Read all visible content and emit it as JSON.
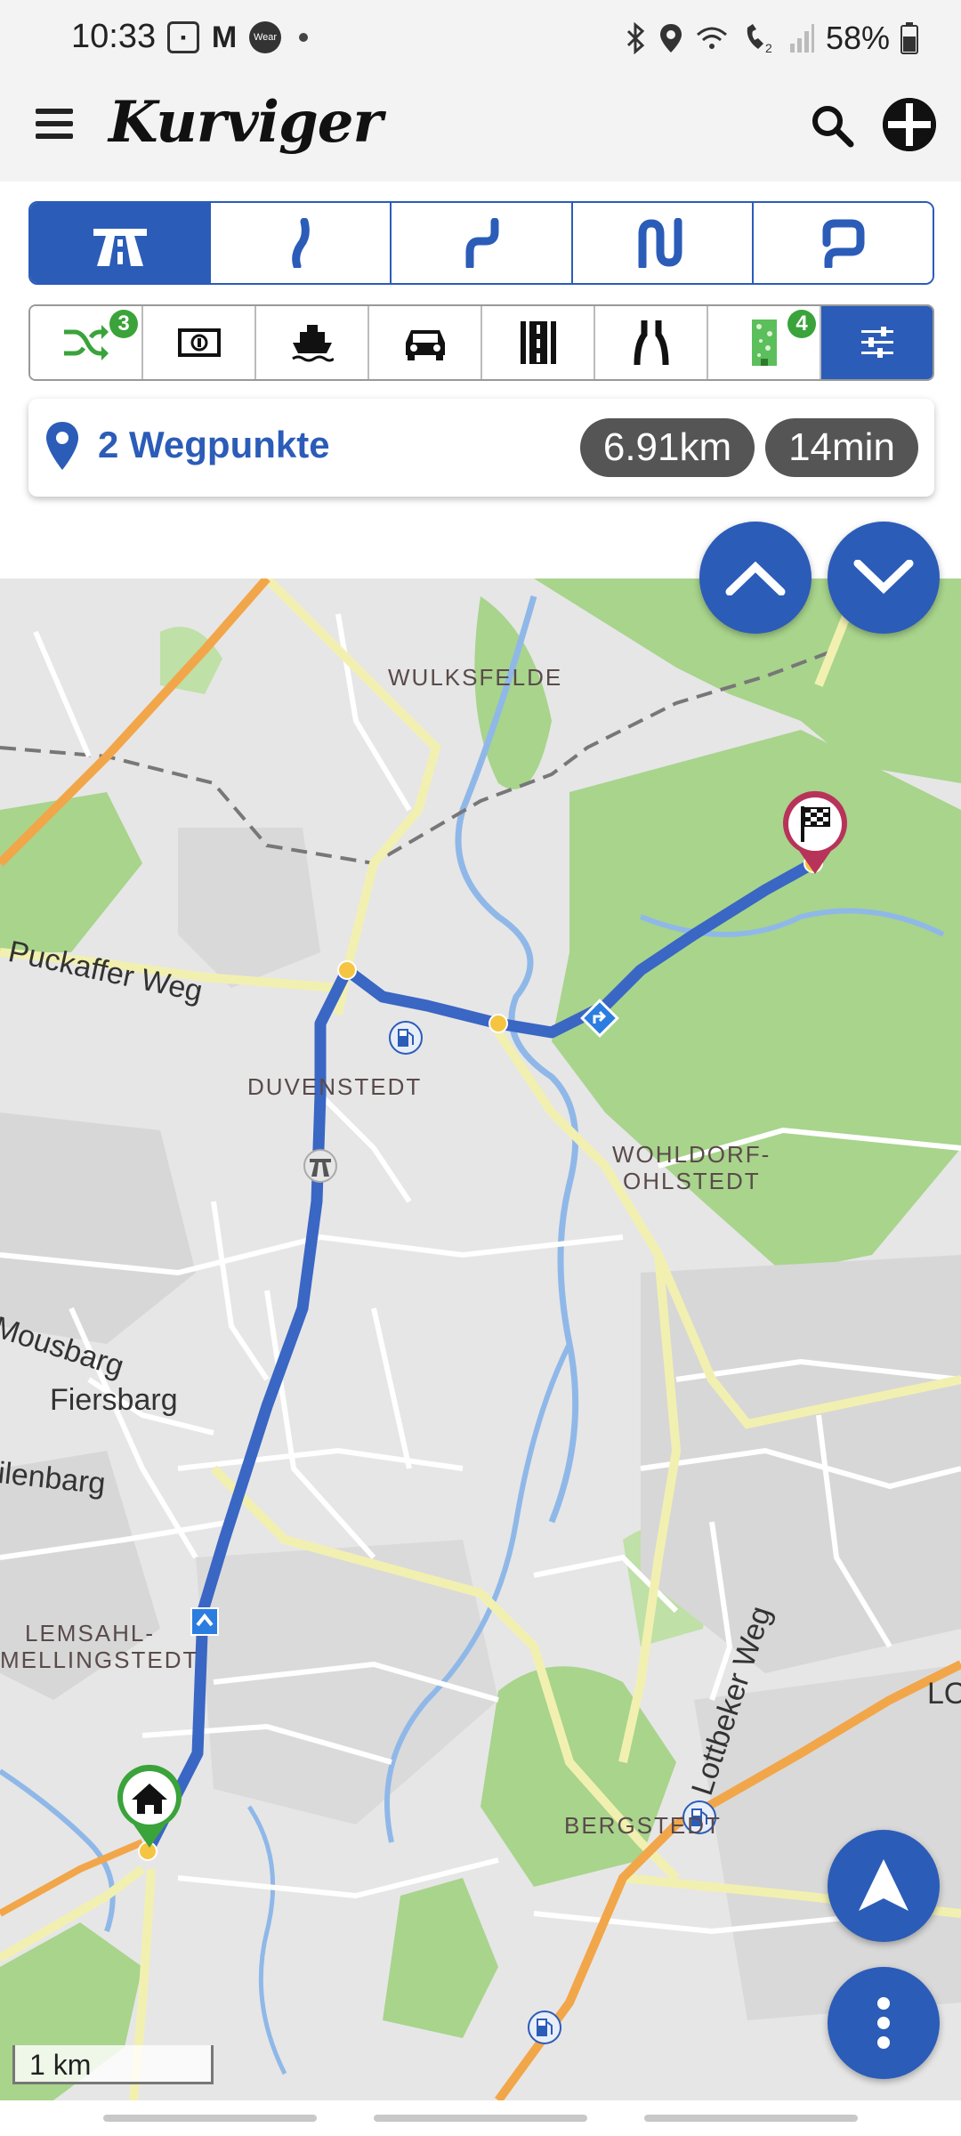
{
  "status_bar": {
    "time": "10:33",
    "battery": "58%",
    "wear_label": "Wear",
    "icons": [
      "folder-icon",
      "gmail-icon",
      "wear-icon",
      "dot-icon",
      "bluetooth-icon",
      "location-icon",
      "wifi-call-icon",
      "vowifi-icon",
      "signal-icon",
      "battery-icon"
    ]
  },
  "app_bar": {
    "logo": "Kurviger",
    "icons": [
      "menu-icon",
      "search-icon",
      "profile-icon"
    ]
  },
  "curviness": {
    "options": [
      {
        "name": "motorway",
        "icon": "motorway-icon",
        "active": true
      },
      {
        "name": "slightly-curvy",
        "icon": "curve-slight-icon",
        "active": false
      },
      {
        "name": "curvy",
        "icon": "curve-medium-icon",
        "active": false
      },
      {
        "name": "very-curvy",
        "icon": "curve-strong-icon",
        "active": false
      },
      {
        "name": "extreme-curvy",
        "icon": "curve-extreme-icon",
        "active": false
      }
    ]
  },
  "route_options": {
    "items": [
      {
        "icon": "shuffle-icon",
        "badge": "3",
        "active": false
      },
      {
        "icon": "toll-money-icon",
        "badge": "",
        "active": false
      },
      {
        "icon": "ferry-icon",
        "badge": "",
        "active": false
      },
      {
        "icon": "car-icon",
        "badge": "",
        "active": false
      },
      {
        "icon": "road-icon",
        "badge": "",
        "active": false
      },
      {
        "icon": "narrow-road-icon",
        "badge": "",
        "active": false
      },
      {
        "icon": "unpaved-road-icon",
        "badge": "4",
        "active": false
      },
      {
        "icon": "settings-sliders-icon",
        "badge": "",
        "active": true
      }
    ]
  },
  "route_summary": {
    "waypoints_label": "2 Wegpunkte",
    "distance": "6.91km",
    "duration": "14min"
  },
  "map": {
    "place_labels": [
      "WULKSFELDE",
      "DUVENSTEDT",
      "WOHLDORF-",
      "OHLSTEDT",
      "LEMSAHL-",
      "MELLINGSTEDT",
      "BERGSTEDT"
    ],
    "street_labels": [
      "Puckaffer Weg",
      "Mousbarg",
      "Fiersbarg",
      "ilenbarg",
      "Lottbeker Weg",
      "LO"
    ],
    "scale": "1 km",
    "colors": {
      "route": "#3a66c4",
      "primary": "#2b5cb8",
      "forest": "#a8d48c",
      "water": "#8fb8e8",
      "main_road": "#f2f0b0",
      "highway": "#f2a64a"
    }
  }
}
